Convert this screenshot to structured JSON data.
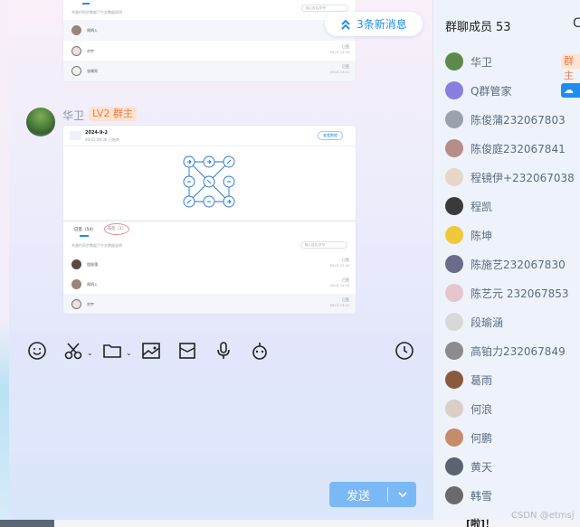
{
  "chat": {
    "new_messages_label": "3条新消息",
    "sender": {
      "name": "华卫",
      "badge": "LV2 群主"
    },
    "card1": {
      "desc": "共邀约同步数据下午交数据说明",
      "search_placeholder": "输入姓名/学号",
      "rows": [
        {
          "name": "周炳入",
          "status": "",
          "time": ""
        },
        {
          "name": "刘宇",
          "status": "已签",
          "time": "09-02 12:16"
        },
        {
          "name": "张晓雨",
          "status": "已签",
          "time": "09-02 13:24"
        }
      ]
    },
    "card2": {
      "title": "2024-9-2",
      "sub1": "09-02 09:30",
      "sub2": "已结束",
      "action": "查看数据",
      "tab_active": "已签（54）",
      "tab_other": "未签（1）",
      "desc": "共邀约同步数据下午交数据说明",
      "search_placeholder": "输入姓名/学号",
      "rows": [
        {
          "name": "程俊蒲",
          "status": "已签",
          "time": "09-02 12:16"
        },
        {
          "name": "周炳入",
          "status": "已签",
          "time": "09-02 12:18"
        },
        {
          "name": "刘宇",
          "status": "已签",
          "time": "09-02 13:15"
        }
      ]
    }
  },
  "compose": {
    "send_label": "发送",
    "toolbar": [
      "emoji-icon",
      "scissors-icon",
      "folder-icon",
      "image-icon",
      "red-packet-icon",
      "microphone-icon",
      "robot-icon",
      "clock-icon"
    ]
  },
  "members_panel": {
    "title": "群聊成员",
    "count": "53",
    "items": [
      {
        "name": "华卫",
        "tag": "群主",
        "tag_type": "owner",
        "color": "#5d8a4a"
      },
      {
        "name": "Q群管家",
        "tag": "",
        "tag_type": "bot",
        "color": "#8a7fe0"
      },
      {
        "name": "陈俊蒲232067803",
        "tag": "",
        "tag_type": "",
        "color": "#9aa3ad"
      },
      {
        "name": "陈俊庭232067841",
        "tag": "",
        "tag_type": "",
        "color": "#b78d8a"
      },
      {
        "name": "程镜伊+232067038",
        "tag": "",
        "tag_type": "",
        "color": "#e8d6c8"
      },
      {
        "name": "程凯",
        "tag": "",
        "tag_type": "",
        "color": "#3a3a3a"
      },
      {
        "name": "陈坤",
        "tag": "",
        "tag_type": "",
        "color": "#f0c93a"
      },
      {
        "name": "陈施艺232067830",
        "tag": "",
        "tag_type": "",
        "color": "#6b6b8a"
      },
      {
        "name": "陈艺元 232067853",
        "tag": "",
        "tag_type": "",
        "color": "#e6c6cc"
      },
      {
        "name": "段瑜涵",
        "tag": "",
        "tag_type": "",
        "color": "#d8d8d8"
      },
      {
        "name": "高铂力232067849",
        "tag": "",
        "tag_type": "",
        "color": "#8c8c8c"
      },
      {
        "name": "葛雨",
        "tag": "",
        "tag_type": "",
        "color": "#8b5a3c"
      },
      {
        "name": "何浪",
        "tag": "",
        "tag_type": "",
        "color": "#d9cfc4"
      },
      {
        "name": "何鹏",
        "tag": "",
        "tag_type": "",
        "color": "#c78a6a"
      },
      {
        "name": "黄天",
        "tag": "",
        "tag_type": "",
        "color": "#5a6470"
      },
      {
        "name": "韩雪",
        "tag": "",
        "tag_type": "",
        "color": "#6a6a6a"
      }
    ]
  },
  "bottom": {
    "text": "[啦]！",
    "watermark": "CSDN @etmsj"
  }
}
